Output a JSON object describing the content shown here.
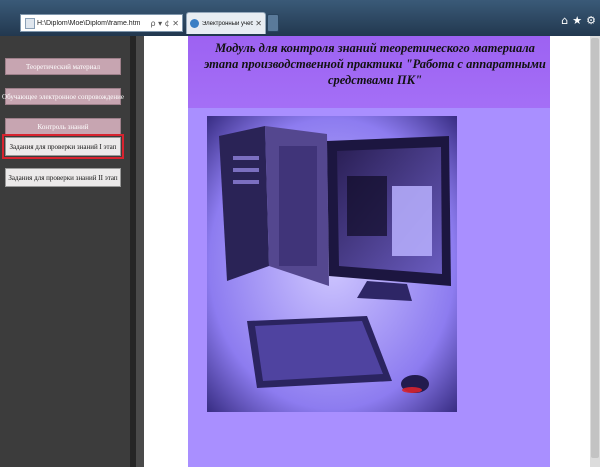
{
  "browser": {
    "address_url": "H:\\Diplom\\Moe\\Diplom\\frame.htm",
    "address_controls": "ρ ▾ ¢ ✕",
    "tab_title": "Электронный учебник по ...",
    "tab_close": "✕",
    "tools": [
      "⌂",
      "★",
      "⚙"
    ]
  },
  "sidebar": {
    "items": [
      {
        "label": "Теоретический материал"
      },
      {
        "label": "Обучающее электронное сопровождение"
      },
      {
        "label": "Контроль знаний"
      },
      {
        "label": "Задания для проверки знаний I этап"
      },
      {
        "label": "Задания для проверки знаний II этап"
      }
    ]
  },
  "main": {
    "title": "Модуль для контроля знаний теоретического материала этапа производственной практики \"Работа с аппаратными средствами ПК\""
  },
  "colors": {
    "header_purple": "#9d62f2",
    "content_violet": "#a98fff",
    "nav_pink": "#c7a5b1",
    "active_outline": "#d8232f"
  }
}
